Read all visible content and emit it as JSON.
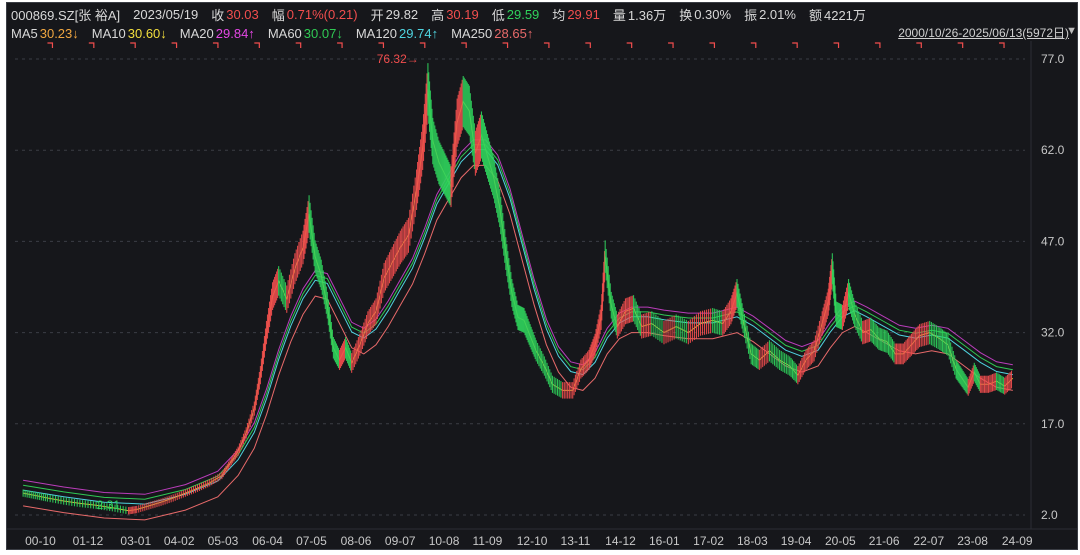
{
  "header": {
    "code": "000869.SZ[张 裕A]",
    "date": "2023/05/19",
    "close_label": "收",
    "close": "30.03",
    "change_label": "幅",
    "change": "0.71%(0.21)",
    "open_label": "开",
    "open": "29.82",
    "high_label": "高",
    "high": "30.19",
    "low_label": "低",
    "low": "29.59",
    "avg_label": "均",
    "avg": "29.91",
    "volume_label": "量",
    "volume": "1.36万",
    "turnover_label": "换",
    "turnover": "0.30%",
    "amplitude_label": "振",
    "amplitude": "2.01%",
    "amount_label": "额",
    "amount": "4221万"
  },
  "ma_row": {
    "ma5_label": "MA5",
    "ma5": "30.23↓",
    "ma10_label": "MA10",
    "ma10": "30.60↓",
    "ma20_label": "MA20",
    "ma20": "29.84↑",
    "ma60_label": "MA60",
    "ma60": "30.07↓",
    "ma120_label": "MA120",
    "ma120": "29.74↑",
    "ma250_label": "MA250",
    "ma250": "28.65↑",
    "date_range": "2000/10/26-2025/06/13(5972日)"
  },
  "colors": {
    "background": "#16171b",
    "up": "#f24e4e",
    "down": "#2fd35c",
    "ma5": "#f0a640",
    "ma10": "#f3df3e",
    "ma20": "#e447e4",
    "ma60": "#30c954",
    "ma120": "#4fd3df",
    "ma250": "#e86a6a",
    "grid": "#3b3e45",
    "axis_text": "#c8c8c8"
  },
  "chart_data": {
    "type": "line",
    "series_kind": "candlestick price with moving averages",
    "grid": true,
    "y_ticks": [
      "77.0",
      "62.0",
      "47.0",
      "32.0",
      "17.0",
      "2.0"
    ],
    "ylim": [
      2.0,
      77.0
    ],
    "x_ticks": [
      "00-10",
      "01-12",
      "03-01",
      "04-02",
      "05-03",
      "06-04",
      "07-05",
      "08-06",
      "09-07",
      "10-08",
      "11-09",
      "12-10",
      "13-11",
      "14-12",
      "16-01",
      "17-02",
      "18-03",
      "19-04",
      "20-05",
      "21-06",
      "22-07",
      "23-08",
      "24-09"
    ],
    "x_positions": [
      0,
      1.17,
      2.35,
      3.42,
      4.5,
      5.6,
      6.68,
      7.78,
      8.87,
      9.95,
      11.03,
      12.12,
      13.2,
      14.3,
      15.38,
      16.47,
      17.55,
      18.63,
      19.72,
      20.8,
      21.9,
      22.98,
      24.08
    ],
    "x_range": [
      -0.2,
      24.7
    ],
    "price_points": [
      [
        0,
        5.6
      ],
      [
        0.3,
        5.2
      ],
      [
        0.6,
        4.8
      ],
      [
        1.0,
        4.3
      ],
      [
        1.4,
        3.9
      ],
      [
        1.8,
        3.6
      ],
      [
        2.2,
        3.2
      ],
      [
        2.6,
        2.7
      ],
      [
        2.8,
        2.9
      ],
      [
        3.1,
        3.5
      ],
      [
        3.4,
        4.1
      ],
      [
        3.7,
        4.8
      ],
      [
        4.0,
        5.6
      ],
      [
        4.3,
        6.4
      ],
      [
        4.6,
        7.3
      ],
      [
        4.9,
        8.5
      ],
      [
        5.1,
        10.5
      ],
      [
        5.3,
        12.5
      ],
      [
        5.5,
        15.5
      ],
      [
        5.7,
        19.5
      ],
      [
        5.85,
        25.0
      ],
      [
        6.0,
        32.0
      ],
      [
        6.15,
        38.0
      ],
      [
        6.3,
        40.5
      ],
      [
        6.5,
        37.5
      ],
      [
        6.7,
        42.5
      ],
      [
        6.9,
        46.0
      ],
      [
        7.05,
        51.5
      ],
      [
        7.2,
        44.5
      ],
      [
        7.35,
        41.5
      ],
      [
        7.5,
        36.5
      ],
      [
        7.65,
        29.5
      ],
      [
        7.8,
        27.5
      ],
      [
        7.95,
        29.5
      ],
      [
        8.1,
        27.0
      ],
      [
        8.3,
        30.0
      ],
      [
        8.5,
        33.5
      ],
      [
        8.7,
        35.5
      ],
      [
        8.9,
        41.0
      ],
      [
        9.1,
        43.5
      ],
      [
        9.3,
        46.0
      ],
      [
        9.5,
        48.0
      ],
      [
        9.7,
        55.5
      ],
      [
        9.85,
        62.5
      ],
      [
        9.98,
        72.0
      ],
      [
        10.1,
        63.5
      ],
      [
        10.25,
        60.0
      ],
      [
        10.4,
        58.0
      ],
      [
        10.55,
        56.0
      ],
      [
        10.7,
        66.5
      ],
      [
        10.85,
        70.0
      ],
      [
        11.0,
        68.5
      ],
      [
        11.15,
        61.5
      ],
      [
        11.3,
        64.5
      ],
      [
        11.45,
        61.0
      ],
      [
        11.6,
        57.5
      ],
      [
        11.75,
        52.5
      ],
      [
        11.9,
        45.0
      ],
      [
        12.05,
        38.5
      ],
      [
        12.2,
        34.5
      ],
      [
        12.35,
        34.0
      ],
      [
        12.5,
        31.5
      ],
      [
        12.65,
        29.0
      ],
      [
        12.85,
        26.5
      ],
      [
        13.05,
        23.5
      ],
      [
        13.3,
        22.5
      ],
      [
        13.55,
        22.5
      ],
      [
        13.75,
        26.0
      ],
      [
        13.95,
        27.5
      ],
      [
        14.1,
        30.0
      ],
      [
        14.25,
        34.5
      ],
      [
        14.35,
        44.5
      ],
      [
        14.5,
        36.5
      ],
      [
        14.65,
        33.0
      ],
      [
        14.85,
        35.5
      ],
      [
        15.05,
        36.0
      ],
      [
        15.25,
        33.0
      ],
      [
        15.5,
        33.5
      ],
      [
        15.8,
        32.0
      ],
      [
        16.1,
        33.0
      ],
      [
        16.4,
        32.0
      ],
      [
        16.7,
        33.5
      ],
      [
        17.0,
        34.0
      ],
      [
        17.25,
        33.5
      ],
      [
        17.45,
        35.5
      ],
      [
        17.6,
        38.5
      ],
      [
        17.75,
        34.0
      ],
      [
        17.95,
        28.5
      ],
      [
        18.15,
        27.5
      ],
      [
        18.4,
        29.0
      ],
      [
        18.65,
        27.5
      ],
      [
        18.9,
        26.5
      ],
      [
        19.1,
        25.0
      ],
      [
        19.3,
        27.5
      ],
      [
        19.5,
        29.0
      ],
      [
        19.7,
        33.5
      ],
      [
        19.85,
        37.0
      ],
      [
        19.95,
        42.5
      ],
      [
        20.05,
        35.0
      ],
      [
        20.2,
        34.5
      ],
      [
        20.35,
        38.5
      ],
      [
        20.5,
        35.0
      ],
      [
        20.7,
        32.0
      ],
      [
        20.9,
        32.5
      ],
      [
        21.1,
        31.0
      ],
      [
        21.3,
        30.5
      ],
      [
        21.5,
        28.5
      ],
      [
        21.7,
        28.5
      ],
      [
        21.9,
        30.0
      ],
      [
        22.1,
        31.5
      ],
      [
        22.35,
        32.0
      ],
      [
        22.6,
        31.0
      ],
      [
        22.8,
        30.0
      ],
      [
        23.0,
        26.0
      ],
      [
        23.15,
        24.5
      ],
      [
        23.3,
        23.0
      ],
      [
        23.45,
        25.5
      ],
      [
        23.6,
        23.5
      ],
      [
        23.8,
        23.5
      ],
      [
        24.0,
        24.0
      ],
      [
        24.2,
        23.2
      ],
      [
        24.4,
        24.5
      ]
    ],
    "ma_trend_points": [
      [
        0,
        5.5
      ],
      [
        1.0,
        4.4
      ],
      [
        2.0,
        3.5
      ],
      [
        3.0,
        3.2
      ],
      [
        4.0,
        4.8
      ],
      [
        4.8,
        7.0
      ],
      [
        5.3,
        10.5
      ],
      [
        5.7,
        15.0
      ],
      [
        6.0,
        20.5
      ],
      [
        6.3,
        27.0
      ],
      [
        6.6,
        32.5
      ],
      [
        6.9,
        37.0
      ],
      [
        7.2,
        40.0
      ],
      [
        7.5,
        39.5
      ],
      [
        7.8,
        35.5
      ],
      [
        8.1,
        31.5
      ],
      [
        8.4,
        30.5
      ],
      [
        8.7,
        32.0
      ],
      [
        9.0,
        35.0
      ],
      [
        9.3,
        38.5
      ],
      [
        9.6,
        42.0
      ],
      [
        9.9,
        47.0
      ],
      [
        10.2,
        52.5
      ],
      [
        10.5,
        56.0
      ],
      [
        10.8,
        59.5
      ],
      [
        11.1,
        61.5
      ],
      [
        11.4,
        61.5
      ],
      [
        11.7,
        59.0
      ],
      [
        12.0,
        53.5
      ],
      [
        12.3,
        46.0
      ],
      [
        12.6,
        38.5
      ],
      [
        12.9,
        32.0
      ],
      [
        13.2,
        27.5
      ],
      [
        13.5,
        25.0
      ],
      [
        13.8,
        24.5
      ],
      [
        14.1,
        26.5
      ],
      [
        14.4,
        30.5
      ],
      [
        14.7,
        33.0
      ],
      [
        15.0,
        34.0
      ],
      [
        15.4,
        34.0
      ],
      [
        15.8,
        33.5
      ],
      [
        16.4,
        33.0
      ],
      [
        17.0,
        33.0
      ],
      [
        17.6,
        34.0
      ],
      [
        18.0,
        32.5
      ],
      [
        18.4,
        30.5
      ],
      [
        18.8,
        28.5
      ],
      [
        19.2,
        27.5
      ],
      [
        19.6,
        28.5
      ],
      [
        19.9,
        31.5
      ],
      [
        20.2,
        34.0
      ],
      [
        20.5,
        35.0
      ],
      [
        20.8,
        34.0
      ],
      [
        21.2,
        32.5
      ],
      [
        21.6,
        31.0
      ],
      [
        22.0,
        30.5
      ],
      [
        22.4,
        31.0
      ],
      [
        22.8,
        30.5
      ],
      [
        23.2,
        28.5
      ],
      [
        23.6,
        26.5
      ],
      [
        24.0,
        25.0
      ],
      [
        24.4,
        24.5
      ]
    ],
    "annotations": [
      {
        "text": "76.32→",
        "x": 10.0,
        "y": 76.32
      },
      {
        "text": "2.31",
        "x": 2.8,
        "y": 2.31
      }
    ]
  }
}
